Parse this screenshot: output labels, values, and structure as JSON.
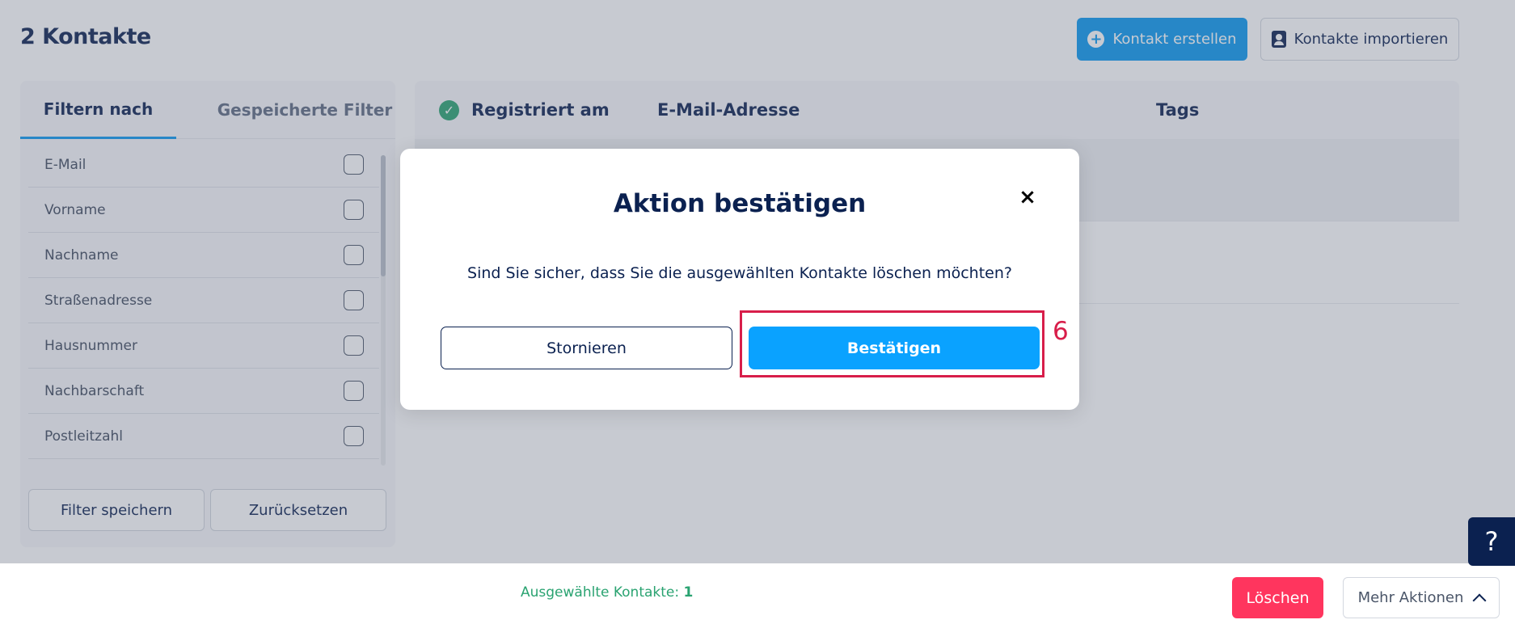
{
  "page": {
    "title": "2 Kontakte",
    "create_contact_label": "Kontakt erstellen",
    "import_contacts_label": "Kontakte importieren"
  },
  "filters": {
    "tabs": [
      {
        "label": "Filtern nach",
        "active": true
      },
      {
        "label": "Gespeicherte Filter",
        "active": false
      }
    ],
    "items": [
      {
        "label": "E-Mail",
        "checked": false
      },
      {
        "label": "Vorname",
        "checked": false
      },
      {
        "label": "Nachname",
        "checked": false
      },
      {
        "label": "Straßenadresse",
        "checked": false
      },
      {
        "label": "Hausnummer",
        "checked": false
      },
      {
        "label": "Nachbarschaft",
        "checked": false
      },
      {
        "label": "Postleitzahl",
        "checked": false
      }
    ],
    "save_label": "Filter speichern",
    "reset_label": "Zurücksetzen"
  },
  "table": {
    "columns": [
      "Registriert am",
      "E-Mail-Adresse",
      "Tags"
    ]
  },
  "bottom_bar": {
    "selected_label": "Ausgewählte Kontakte:",
    "selected_count": "1",
    "delete_label": "Löschen",
    "more_actions_label": "Mehr Aktionen"
  },
  "help": {
    "label": "?"
  },
  "modal": {
    "title": "Aktion bestätigen",
    "close_symbol": "×",
    "message": "Sind Sie sicher, dass Sie die ausgewählten Kontakte löschen möchten?",
    "cancel_label": "Stornieren",
    "confirm_label": "Bestätigen"
  },
  "annotation": {
    "label": "6",
    "color": "#d81e4a"
  },
  "colors": {
    "primary": "#0a99f0",
    "navy": "#0b2150",
    "success": "#2aa371",
    "danger": "#ff355e"
  }
}
